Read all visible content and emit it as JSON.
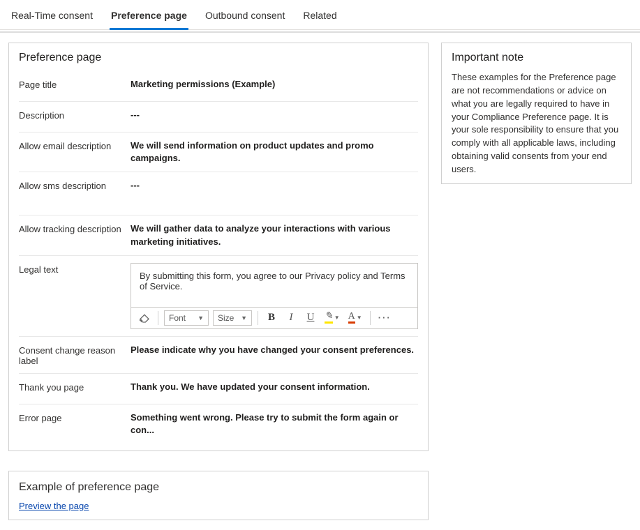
{
  "tabs": {
    "items": [
      {
        "label": "Real-Time consent"
      },
      {
        "label": "Preference page"
      },
      {
        "label": "Outbound consent"
      },
      {
        "label": "Related"
      }
    ],
    "activeIndex": 1
  },
  "preferencePage": {
    "cardTitle": "Preference page",
    "fields": {
      "pageTitle": {
        "label": "Page title",
        "value": "Marketing permissions (Example)"
      },
      "description": {
        "label": "Description",
        "value": "---"
      },
      "allowEmail": {
        "label": "Allow email description",
        "value": "We will send information on product updates and promo campaigns."
      },
      "allowSms": {
        "label": "Allow sms description",
        "value": "---"
      },
      "allowTracking": {
        "label": "Allow tracking description",
        "value": "We will gather data to analyze your interactions with various marketing initiatives."
      },
      "legalText": {
        "label": "Legal text",
        "value": "By submitting this form, you agree to our Privacy policy and Terms of Service."
      },
      "consentChange": {
        "label": "Consent change reason label",
        "value": "Please indicate why you have changed your consent preferences."
      },
      "thankYou": {
        "label": "Thank you page",
        "value": "Thank you. We have updated your consent information."
      },
      "errorPage": {
        "label": "Error page",
        "value": "Something went wrong. Please try to submit the form again or con..."
      }
    }
  },
  "importantNote": {
    "title": "Important note",
    "body": "These examples for the Preference page are not recommendations or advice on what you are legally required to have in your Compliance Preference page. It is your sole responsibility to ensure that you comply with all applicable laws, including obtaining valid consents from your end users."
  },
  "previewCard": {
    "title": "Example of preference page",
    "link": "Preview the page"
  },
  "rte": {
    "fontLabel": "Font",
    "sizeLabel": "Size"
  }
}
